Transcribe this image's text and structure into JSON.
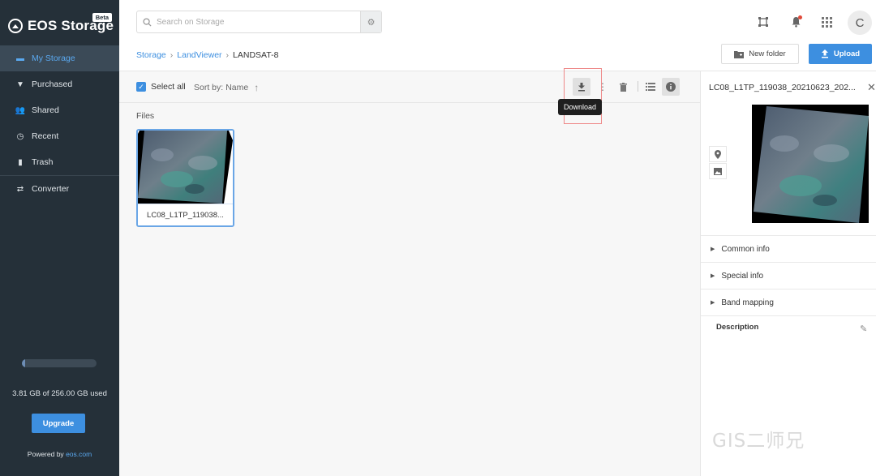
{
  "brand": {
    "name": "EOS Storage",
    "badge": "Beta"
  },
  "nav": [
    {
      "label": "My Storage",
      "icon": "folder-icon",
      "glyph": "▬",
      "active": true
    },
    {
      "label": "Purchased",
      "icon": "basket-icon",
      "glyph": "▼",
      "active": false
    },
    {
      "label": "Shared",
      "icon": "people-icon",
      "glyph": "👥",
      "active": false
    },
    {
      "label": "Recent",
      "icon": "clock-icon",
      "glyph": "◷",
      "active": false
    },
    {
      "label": "Trash",
      "icon": "trash-icon",
      "glyph": "▮",
      "active": false
    },
    {
      "label": "Converter",
      "icon": "swap-icon",
      "glyph": "⇄",
      "active": false
    }
  ],
  "storage": {
    "used_fraction": 0.015,
    "text": "3.81 GB of 256.00 GB used",
    "upgrade_label": "Upgrade"
  },
  "powered": {
    "prefix": "Powered by",
    "link": "eos.com"
  },
  "search": {
    "placeholder": "Search on Storage"
  },
  "user": {
    "avatar_letter": "C"
  },
  "breadcrumb": {
    "items": [
      "Storage",
      "LandViewer"
    ],
    "current": "LANDSAT-8"
  },
  "actions": {
    "new_folder": "New folder",
    "upload": "Upload"
  },
  "toolbar": {
    "select_all": "Select all",
    "sort_prefix": "Sort by:",
    "sort_field": "Name",
    "tooltip": "Download"
  },
  "files": {
    "section": "Files",
    "items": [
      {
        "name": "LC08_L1TP_119038..."
      }
    ]
  },
  "panel": {
    "title": "LC08_L1TP_119038_20210623_202...",
    "sections": [
      "Common info",
      "Special info",
      "Band mapping"
    ],
    "description_label": "Description"
  },
  "watermark": "GIS二师兄",
  "colors": {
    "sidebar": "#253039",
    "accent": "#3d8fe0",
    "active_nav": "#3b4a57"
  }
}
